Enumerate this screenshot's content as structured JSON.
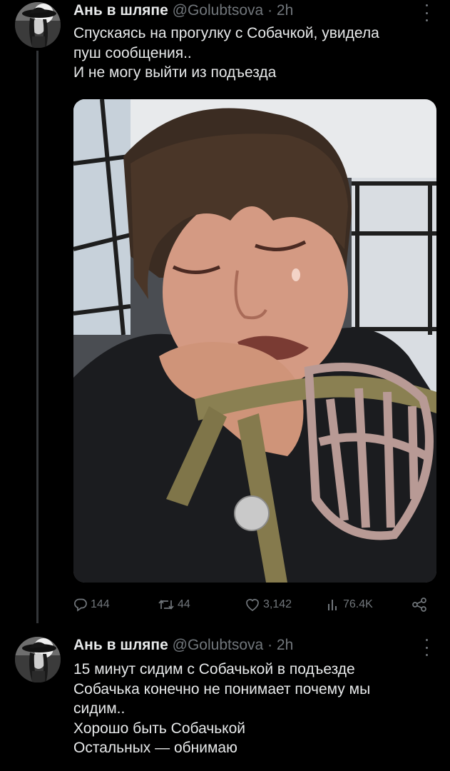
{
  "tweets": [
    {
      "author_name": "Ань в шляпе",
      "handle": "@Golubtsova",
      "time": "· 2h",
      "lines": [
        "Спускаясь на прогулку с Собачкой, увидела",
        "пуш сообщения..",
        "И не могу выйти из подъезда"
      ],
      "stats": {
        "replies": "144",
        "reposts": "44",
        "likes": "3,142",
        "views": "76.4K"
      },
      "icons": {
        "reply": "reply-icon",
        "repost": "repost-icon",
        "like": "heart-icon",
        "views": "views-icon",
        "share": "share-icon",
        "more": "more-icon"
      }
    },
    {
      "author_name": "Ань в шляпе",
      "handle": "@Golubtsova",
      "time": "· 2h",
      "lines": [
        "15 минут сидим  с Собачькой в подъезде",
        "Собачька конечно не понимает почему мы",
        "сидим..",
        "Хорошо быть Собачькой",
        "Остальных — обнимаю"
      ]
    }
  ],
  "colors": {
    "background": "#000000",
    "text": "#e7e9ea",
    "secondary": "#71767b",
    "thread_line": "#333639"
  }
}
